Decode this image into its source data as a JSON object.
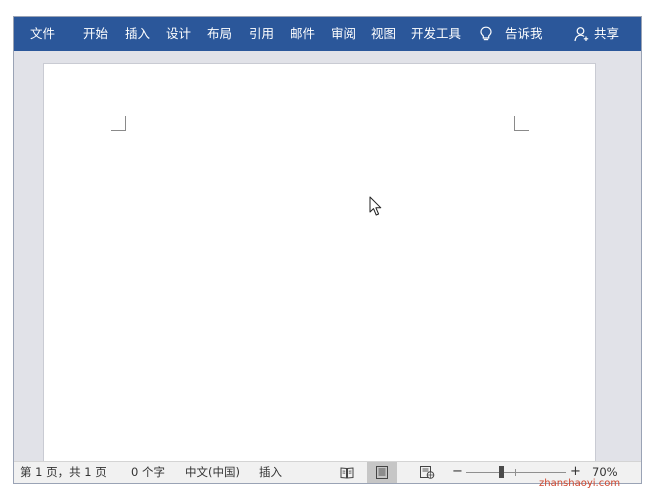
{
  "ribbon": {
    "tabs": [
      {
        "label": "文件"
      },
      {
        "label": "开始"
      },
      {
        "label": "插入"
      },
      {
        "label": "设计"
      },
      {
        "label": "布局"
      },
      {
        "label": "引用"
      },
      {
        "label": "邮件"
      },
      {
        "label": "审阅"
      },
      {
        "label": "视图"
      },
      {
        "label": "开发工具"
      }
    ],
    "tell_me": {
      "label": "告诉我",
      "icon": "lightbulb-icon"
    },
    "share": {
      "label": "共享",
      "icon": "person-icon"
    },
    "background_color": "#2b579a"
  },
  "document": {
    "page_background": "#ffffff",
    "canvas_background": "#e1e2e8"
  },
  "status_bar": {
    "page_info": "第 1 页，共 1 页",
    "word_count": "0 个字",
    "language": "中文(中国)",
    "insert_mode": "插入",
    "views": [
      {
        "name": "read-mode",
        "icon": "book-icon"
      },
      {
        "name": "print-layout",
        "icon": "page-icon",
        "active": true
      },
      {
        "name": "web-layout",
        "icon": "web-page-icon"
      }
    ],
    "zoom": {
      "minus": "−",
      "plus": "+",
      "percent": "70%",
      "level": 0.35
    }
  },
  "watermark": "zhanshaoyi.com"
}
